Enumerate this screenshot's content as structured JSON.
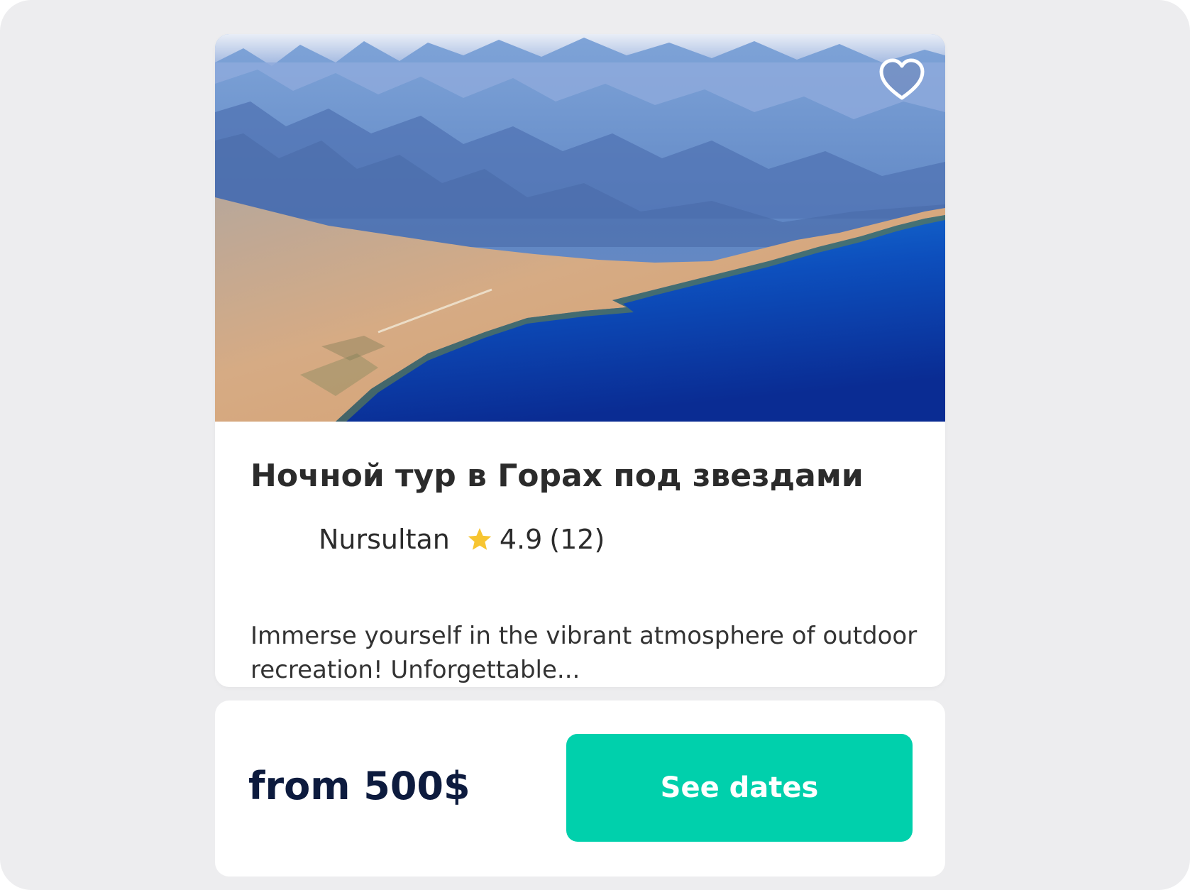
{
  "tour": {
    "title": "Ночной тур в Горах под звездами",
    "guide_name": "Nursultan",
    "rating": "4.9",
    "reviews_count": "(12)",
    "description": "Immerse yourself in the vibrant atmosphere of outdoor recreation! Unforgettable...",
    "favorite_icon": "heart-outline-icon",
    "rating_icon": "star-icon"
  },
  "booking": {
    "price_label": "from 500$",
    "button_label": "See dates"
  },
  "colors": {
    "background": "#ededef",
    "card": "#ffffff",
    "accent": "#00d0ac",
    "price_text": "#0d1b3e",
    "star": "#f7c531",
    "title_text": "#2b2b2b"
  }
}
